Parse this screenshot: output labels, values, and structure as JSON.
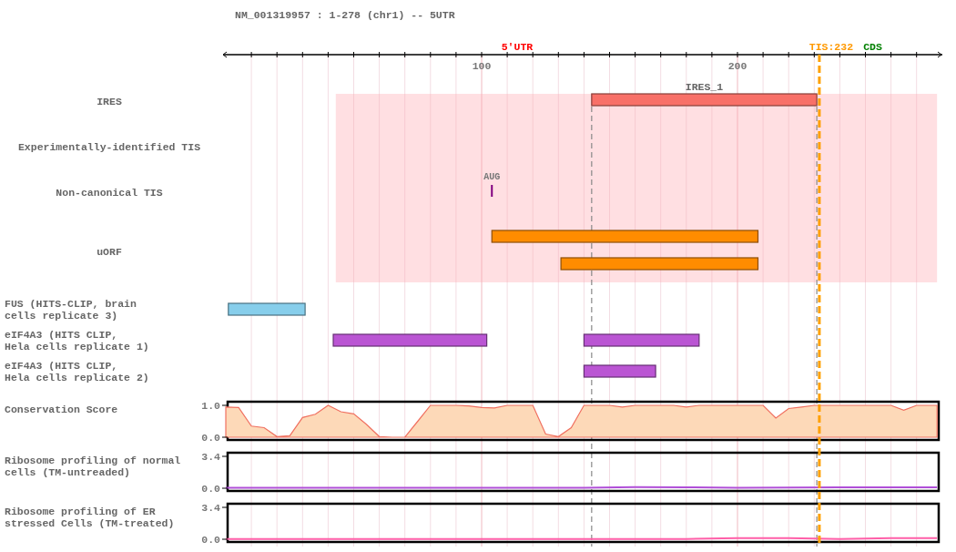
{
  "title": "NM_001319957 : 1-278 (chr1) -- 5UTR",
  "axis": {
    "labels": [
      "100",
      "200"
    ]
  },
  "regions": [
    {
      "label": "5'UTR",
      "color": "#ff0000"
    },
    {
      "label": "CDS",
      "color": "#008000"
    }
  ],
  "tis": {
    "label": "TIS:232"
  },
  "tracks": [
    {
      "kind": "features",
      "label_lines": [
        "IRES"
      ],
      "features": [
        {
          "label": "IRES_1"
        }
      ]
    },
    {
      "kind": "features",
      "label_lines": [
        "Experimentally-identified TIS"
      ]
    },
    {
      "kind": "sites",
      "label_lines": [
        "Non-canonical TIS"
      ],
      "sites": [
        {
          "label": "AUG"
        }
      ]
    },
    {
      "kind": "features",
      "label_lines": [
        "uORF"
      ]
    },
    {
      "kind": "features",
      "label_lines": [
        "FUS (HITS-CLIP, brain",
        "cells replicate 3)"
      ]
    },
    {
      "kind": "features",
      "label_lines": [
        "eIF4A3 (HITS CLIP,",
        "Hela cells replicate 1)"
      ]
    },
    {
      "kind": "features",
      "label_lines": [
        "eIF4A3 (HITS CLIP,",
        "Hela cells replicate 2)"
      ]
    },
    {
      "kind": "signal",
      "label_lines": [
        "Conservation Score"
      ],
      "y_labels": [
        "1.0",
        "0.0"
      ]
    },
    {
      "kind": "signal",
      "label_lines": [
        "Ribosome profiling of normal",
        "cells (TM-untreaded)"
      ],
      "y_labels": [
        "3.4",
        "0.0"
      ]
    },
    {
      "kind": "signal",
      "label_lines": [
        "Ribosome profiling of ER",
        "stressed Cells (TM-treated)"
      ],
      "y_labels": [
        "3.4",
        "0.0"
      ]
    }
  ]
}
